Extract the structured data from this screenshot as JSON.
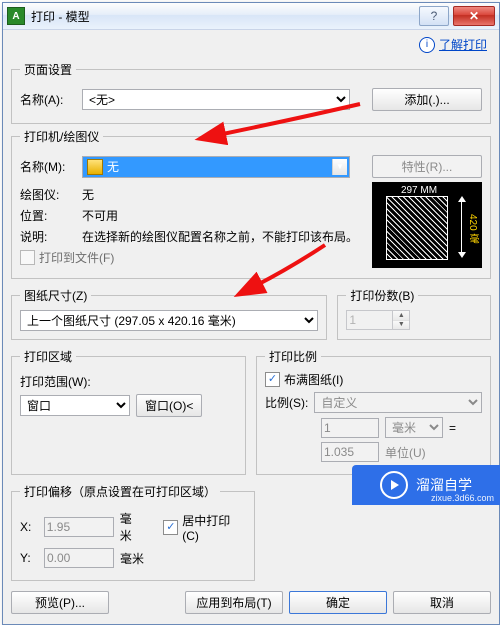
{
  "title": "打印 - 模型",
  "help_link": "了解打印",
  "page_setup": {
    "legend": "页面设置",
    "name_label": "名称(A):",
    "name_value": "<无>",
    "add_button": "添加(.)..."
  },
  "printer": {
    "legend": "打印机/绘图仪",
    "name_label": "名称(M):",
    "name_value": "无",
    "properties_button": "特性(R)...",
    "plotter_label": "绘图仪:",
    "plotter_value": "无",
    "location_label": "位置:",
    "location_value": "不可用",
    "desc_label": "说明:",
    "desc_value": "在选择新的绘图仪配置名称之前，不能打印该布局。",
    "to_file_check": "打印到文件(F)",
    "preview_width": "297 MM",
    "preview_height": "420 毫"
  },
  "paper_size": {
    "legend": "图纸尺寸(Z)",
    "value": "上一个图纸尺寸 (297.05 x 420.16 毫米)"
  },
  "copies": {
    "legend": "打印份数(B)",
    "value": "1"
  },
  "area": {
    "legend": "打印区域",
    "range_label": "打印范围(W):",
    "range_value": "窗口",
    "window_button": "窗口(O)<"
  },
  "scale": {
    "legend": "打印比例",
    "fit_check": "布满图纸(I)",
    "ratio_label": "比例(S):",
    "ratio_value": "自定义",
    "num_value": "1",
    "unit_value": "毫米",
    "equals": "=",
    "unit2_value": "1.035",
    "unit2_label": "单位(U)"
  },
  "offset": {
    "legend": "打印偏移（原点设置在可打印区域）",
    "x_label": "X:",
    "x_value": "1.95",
    "y_label": "Y:",
    "y_value": "0.00",
    "unit": "毫米",
    "center_check": "居中打印(C)"
  },
  "buttons": {
    "preview": "预览(P)...",
    "apply_layout": "应用到布局(T)",
    "ok": "确定",
    "cancel": "取消"
  },
  "logo": {
    "text": "溜溜自学",
    "url": "zixue.3d66.com"
  }
}
